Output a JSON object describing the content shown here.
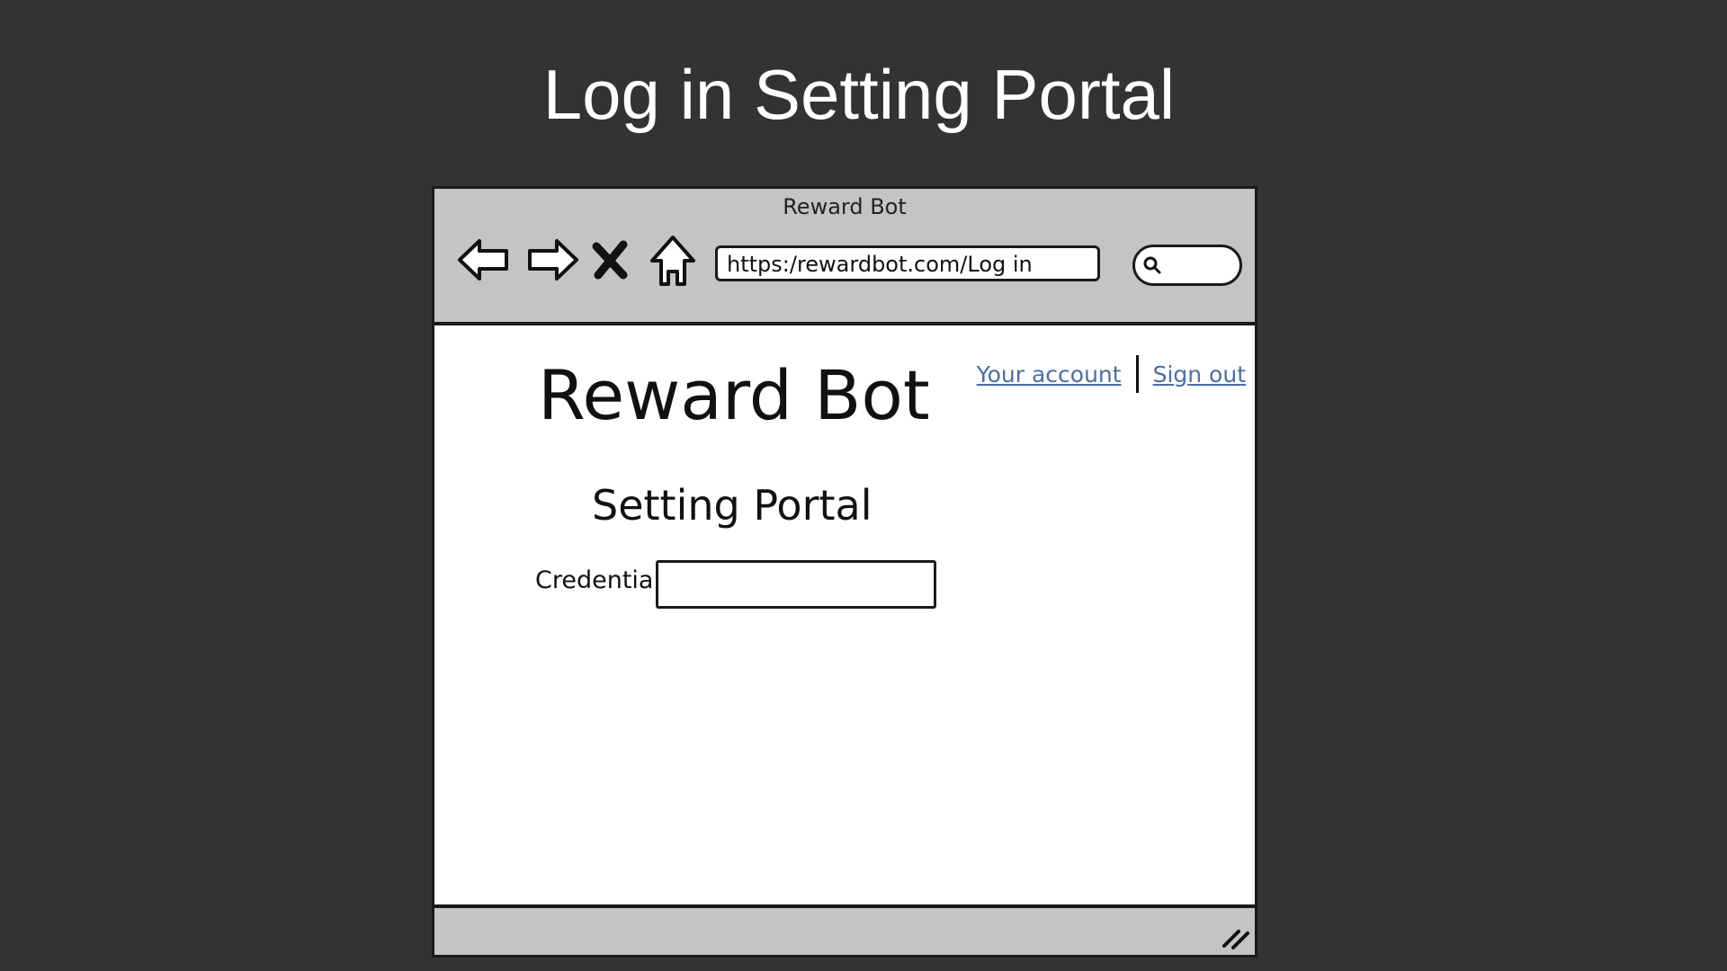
{
  "slide": {
    "title": "Log in Setting Portal"
  },
  "browser": {
    "window_title": "Reward Bot",
    "url": "https:/rewardbot.com/Log in",
    "search_value": "",
    "icons": {
      "back": "back-arrow-icon",
      "forward": "forward-arrow-icon",
      "stop": "close-icon",
      "home": "home-icon",
      "search": "search-icon",
      "resize": "resize-grip-icon"
    }
  },
  "page": {
    "brand": "Reward Bot",
    "links": {
      "account": "Your account",
      "signout": "Sign out"
    },
    "subtitle": "Setting Portal",
    "credential_label": "Credential",
    "credential_value": ""
  },
  "colors": {
    "background": "#333333",
    "chrome": "#c4c4c4",
    "link": "#4a6fa5"
  }
}
